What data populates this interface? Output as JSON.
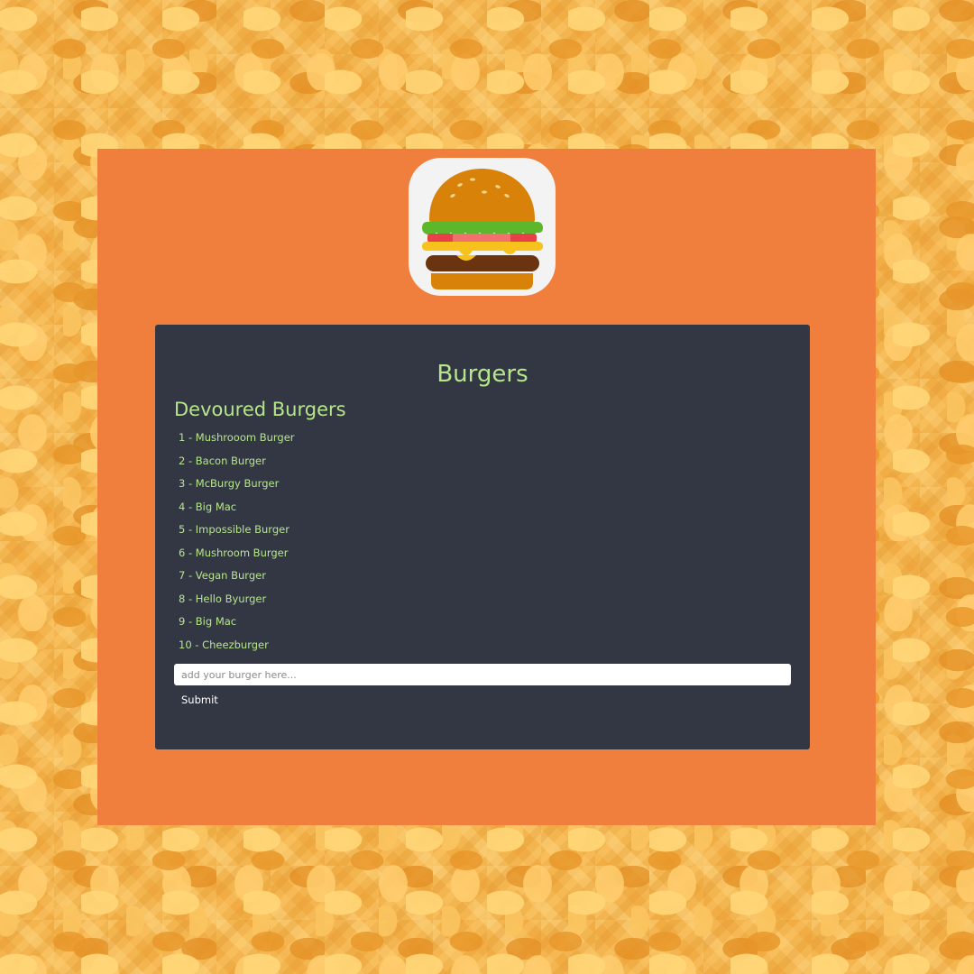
{
  "logo": {
    "icon": "hamburger-icon"
  },
  "panel": {
    "title": "Burgers",
    "devoured_heading": "Devoured Burgers",
    "burgers": [
      "1 - Mushrooom Burger",
      "2 - Bacon Burger",
      "3 - McBurgy Burger",
      "4 - Big Mac",
      "5 - Impossible Burger",
      "6 - Mushroom Burger",
      "7 - Vegan Burger",
      "8 - Hello Byurger",
      "9 - Big Mac",
      "10 - Cheezburger"
    ],
    "input": {
      "placeholder": "add your burger here...",
      "value": ""
    },
    "submit_label": "Submit"
  },
  "colors": {
    "frame": "#f07e3d",
    "panel": "#333744",
    "text": "#b6e68b",
    "button_text": "#ffffff"
  }
}
